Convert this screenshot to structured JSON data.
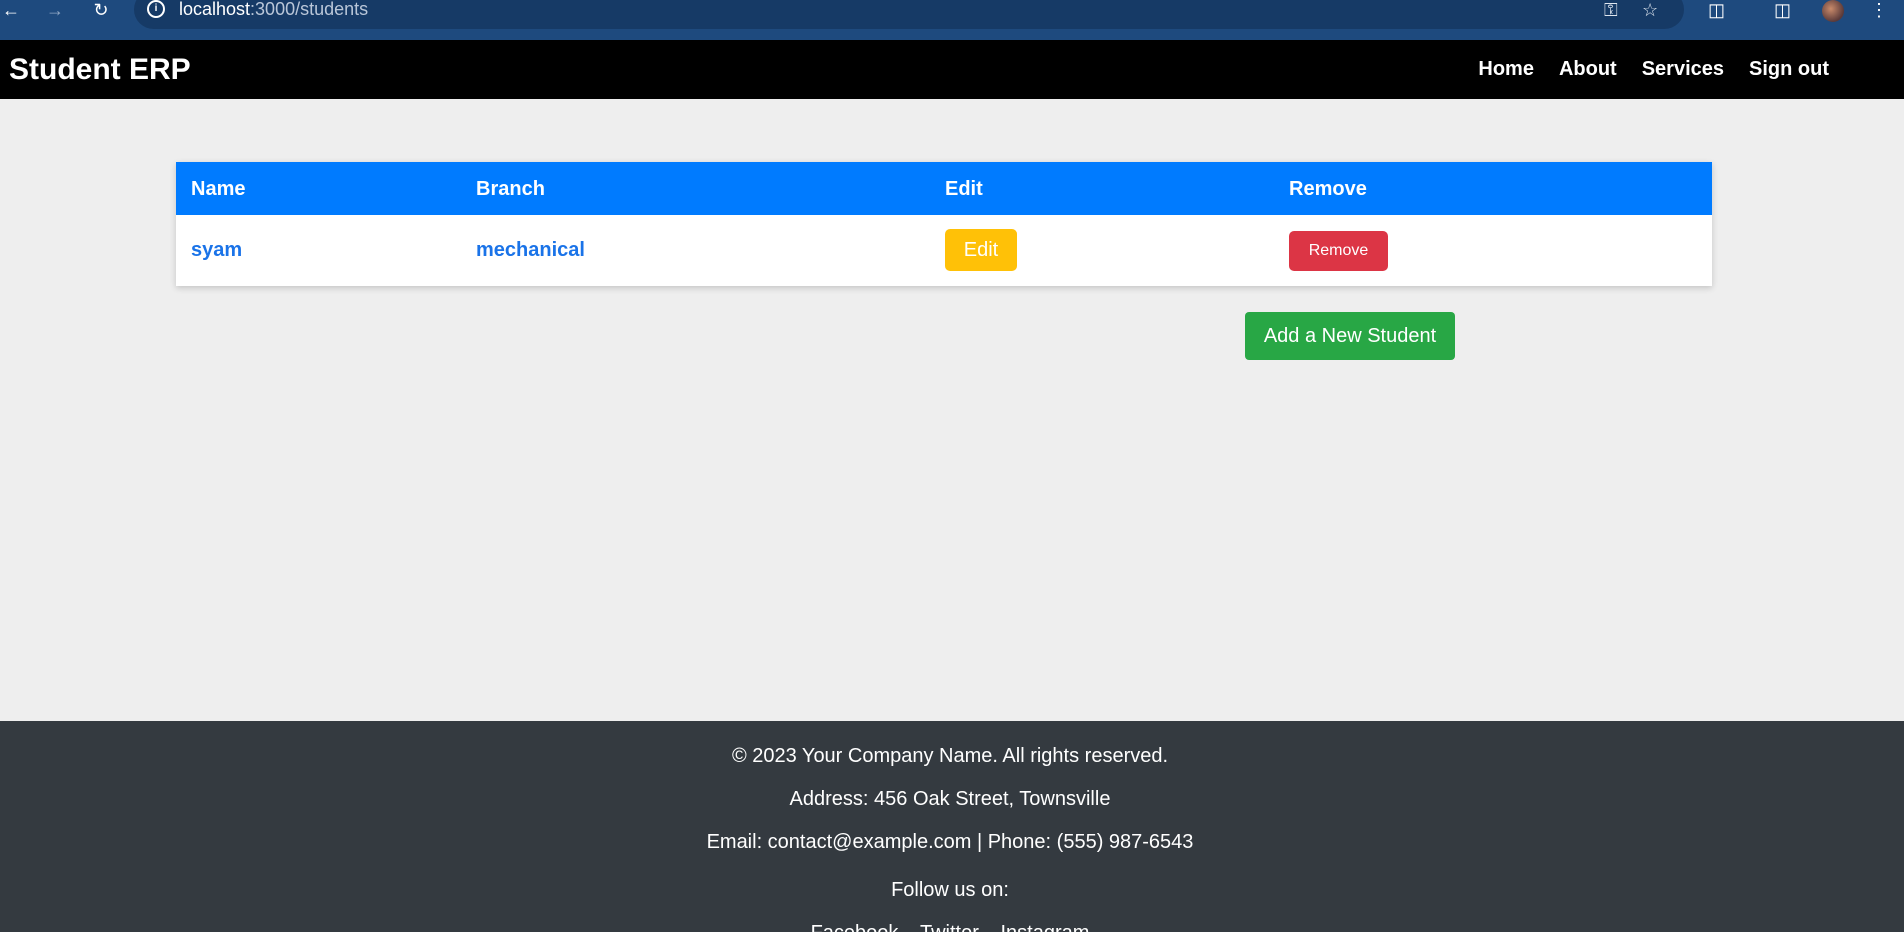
{
  "browser": {
    "url_host": "localhost",
    "url_path": ":3000/students"
  },
  "navbar": {
    "brand": "Student ERP",
    "links": [
      "Home",
      "About",
      "Services",
      "Sign out"
    ]
  },
  "table": {
    "headers": [
      "Name",
      "Branch",
      "Edit",
      "Remove"
    ],
    "rows": [
      {
        "name": "syam",
        "branch": "mechanical",
        "edit_label": "Edit",
        "remove_label": "Remove"
      }
    ]
  },
  "actions": {
    "add_label": "Add a New Student"
  },
  "footer": {
    "copyright": "© 2023 Your Company Name. All rights reserved.",
    "address": "Address: 456 Oak Street, Townsville",
    "contact": "Email: contact@example.com | Phone: (555) 987-6543",
    "follow": "Follow us on:",
    "social": [
      "Facebook",
      "Twitter",
      "Instagram"
    ]
  },
  "colors": {
    "navbar": "#000000",
    "table_header": "#007bff",
    "edit": "#ffc107",
    "remove": "#dc3545",
    "add": "#28a745",
    "footer": "#343a40"
  }
}
